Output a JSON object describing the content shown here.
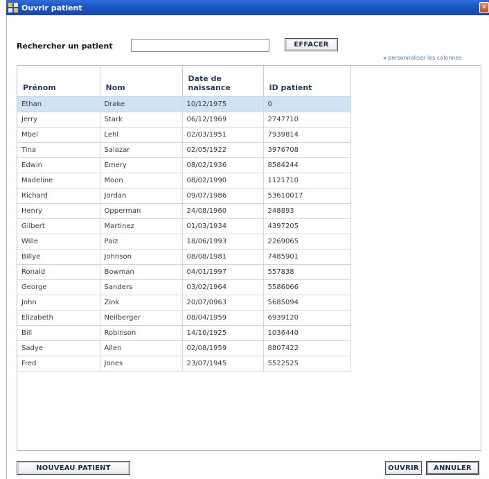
{
  "window": {
    "title": "Ouvrir patient"
  },
  "search": {
    "label": "Rechercher un patient",
    "value": "",
    "placeholder": "",
    "clear_label": "EFFACER",
    "customize_link": "personnaliser les colonnes"
  },
  "table": {
    "headers": [
      "Prénom",
      "Nom",
      "Date de naissance",
      "ID patient"
    ],
    "selected_row": 0,
    "rows": [
      [
        "Ethan",
        "Drake",
        "10/12/1975",
        "0"
      ],
      [
        "Jerry",
        "Stark",
        "06/12/1969",
        "2747710"
      ],
      [
        "Mbel",
        "Lehl",
        "02/03/1951",
        "7939814"
      ],
      [
        "Tina",
        "Salazar",
        "02/05/1922",
        "3976708"
      ],
      [
        "Edwin",
        "Emery",
        "08/02/1936",
        "8584244"
      ],
      [
        "Madeline",
        "Moon",
        "08/02/1990",
        "1121710"
      ],
      [
        "Richard",
        "Jordan",
        "09/07/1986",
        "53610017"
      ],
      [
        "Henry",
        "Opperman",
        "24/08/1960",
        "248893"
      ],
      [
        "Gilbert",
        "Martinez",
        "01/03/1934",
        "4397205"
      ],
      [
        "Wille",
        "Paiz",
        "18/06/1993",
        "2269065"
      ],
      [
        "Billye",
        "Johnson",
        "08/08/1981",
        "7485901"
      ],
      [
        "Ronald",
        "Bowman",
        "04/01/1997",
        "557838"
      ],
      [
        "George",
        "Sanders",
        "03/02/1964",
        "5586066"
      ],
      [
        "John",
        "Zink",
        "20/07/0963",
        "5685094"
      ],
      [
        "Elizabeth",
        "Neilberger",
        "08/04/1959",
        "6939120"
      ],
      [
        "Bill",
        "Robinson",
        "14/10/1925",
        "1036440"
      ],
      [
        "Sadye",
        "Allen",
        "02/08/1959",
        "8807422"
      ],
      [
        "Fred",
        "Jones",
        "23/07/1945",
        "5522525"
      ]
    ]
  },
  "footer": {
    "new_patient_label": "NOUVEAU PATIENT",
    "open_label": "OUVRIR",
    "cancel_label": "ANNULER"
  },
  "icons": {
    "app": "patient-app-icon",
    "close": "close-icon"
  },
  "colors": {
    "titlebar": "#1c55c2",
    "selected_row": "#cfe3f6",
    "header_text": "#283b62",
    "link": "#4f79b6"
  }
}
